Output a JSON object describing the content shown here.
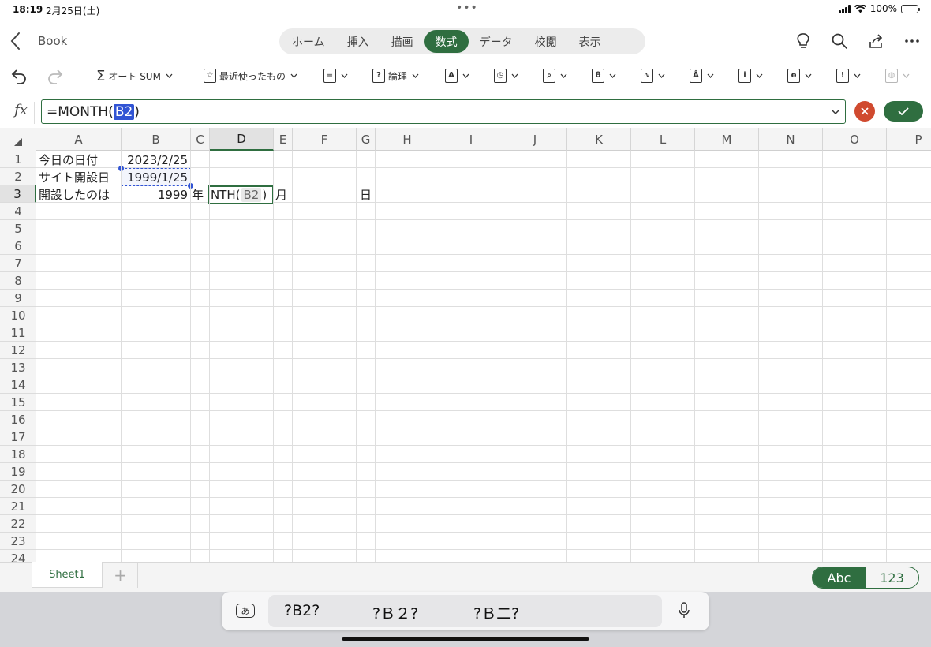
{
  "status_bar": {
    "time": "18:19",
    "date": "2月25日(土)",
    "battery": "100%"
  },
  "title_bar": {
    "book": "Book"
  },
  "ribbon": {
    "tabs": [
      {
        "label": "ホーム"
      },
      {
        "label": "挿入"
      },
      {
        "label": "描画"
      },
      {
        "label": "数式",
        "active": true
      },
      {
        "label": "データ"
      },
      {
        "label": "校閲"
      },
      {
        "label": "表示"
      }
    ]
  },
  "toolbar": {
    "autosum": "オート SUM",
    "recent": "最近使ったもの",
    "logic": "論理",
    "icons": [
      "financial-icon",
      "text-icon",
      "datetime-icon",
      "lookup-icon",
      "math-icon",
      "more-functions-icon",
      "text-functions-icon",
      "info-icon",
      "engineering-icon",
      "error-check-icon",
      "web-icon"
    ]
  },
  "formula_bar": {
    "fx": "fx",
    "prefix": "=MONTH(",
    "ref": "B2",
    "suffix": ")"
  },
  "columns": [
    "A",
    "B",
    "C",
    "D",
    "E",
    "F",
    "G",
    "H",
    "I",
    "J",
    "K",
    "L",
    "M",
    "N",
    "O",
    "P"
  ],
  "rows": [
    "1",
    "2",
    "3",
    "4",
    "5",
    "6",
    "7",
    "8",
    "9",
    "10",
    "11",
    "12",
    "13",
    "14",
    "15",
    "16",
    "17",
    "18",
    "19",
    "20",
    "21",
    "22",
    "23",
    "24"
  ],
  "cells": {
    "A1": "今日の日付",
    "B1": "2023/2/25",
    "A2": "サイト開設日",
    "B2": "1999/1/25",
    "A3": "開設したのは",
    "B3": "1999",
    "C3": "年",
    "E3": "月",
    "G3": "日"
  },
  "active_cell": {
    "prefix": "NTH(",
    "ref": "B2",
    "suffix": ")"
  },
  "sheets": {
    "tab": "Sheet1",
    "add": "+"
  },
  "keyboard_mode": {
    "abc": "Abc",
    "num": "123"
  },
  "candidates": {
    "ime": "あ",
    "items": [
      "?B2?",
      "?Ｂ２?",
      "?Ｂ二?"
    ]
  },
  "colors": {
    "accent": "#2f6e40",
    "reference": "#3154d4",
    "cancel": "#d04a2f"
  }
}
